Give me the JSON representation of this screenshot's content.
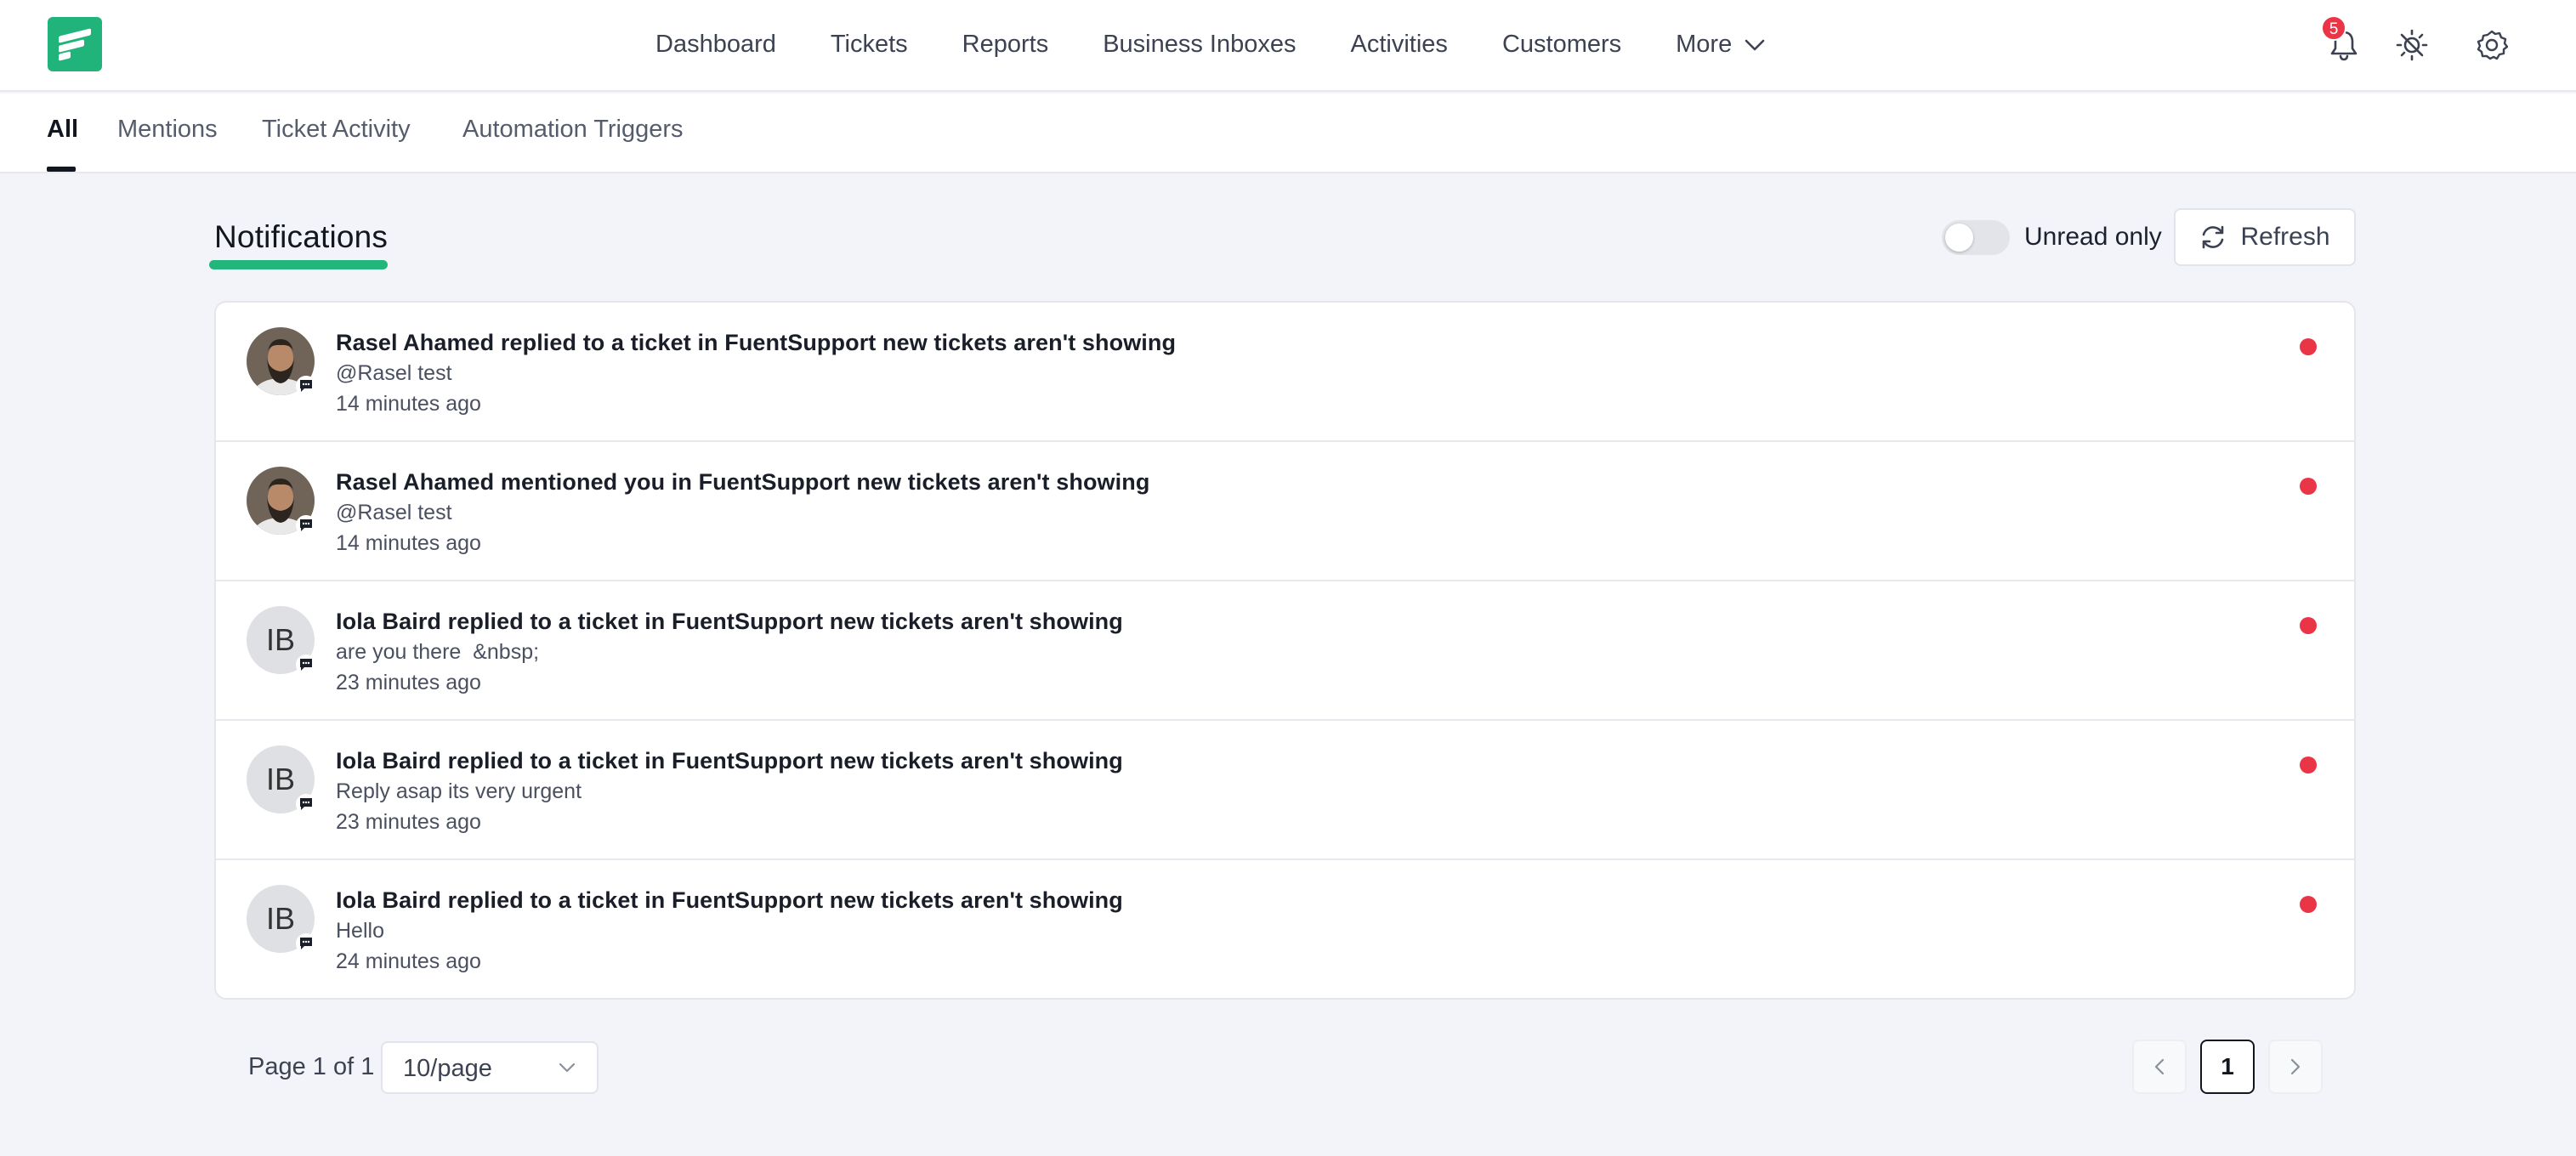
{
  "nav": {
    "items": [
      {
        "label": "Dashboard"
      },
      {
        "label": "Tickets"
      },
      {
        "label": "Reports"
      },
      {
        "label": "Business Inboxes"
      },
      {
        "label": "Activities"
      },
      {
        "label": "Customers"
      },
      {
        "label": "More"
      }
    ],
    "notification_count": "5",
    "icons": [
      "bell-icon",
      "theme-toggle-icon",
      "settings-gear-icon"
    ]
  },
  "tabs": [
    {
      "label": "All",
      "active": true
    },
    {
      "label": "Mentions"
    },
    {
      "label": "Ticket Activity"
    },
    {
      "label": "Automation Triggers"
    }
  ],
  "header": {
    "title": "Notifications",
    "unread_only_label": "Unread only",
    "unread_only_enabled": false,
    "refresh_label": "Refresh"
  },
  "notifications": [
    {
      "avatar": "photo",
      "title": "Rasel Ahamed replied to a ticket in FuentSupport new tickets aren't showing",
      "body": "@Rasel test",
      "time": "14 minutes ago",
      "unread": true
    },
    {
      "avatar": "photo",
      "title": "Rasel Ahamed mentioned you in FuentSupport new tickets aren't showing",
      "body": "@Rasel test",
      "time": "14 minutes ago",
      "unread": true
    },
    {
      "avatar_initials": "IB",
      "title": "Iola Baird replied to a ticket in FuentSupport new tickets aren't showing",
      "body": "are you there  &nbsp;",
      "time": "23 minutes ago",
      "unread": true
    },
    {
      "avatar_initials": "IB",
      "title": "Iola Baird replied to a ticket in FuentSupport new tickets aren't showing",
      "body": "Reply asap its very urgent",
      "time": "23 minutes ago",
      "unread": true
    },
    {
      "avatar_initials": "IB",
      "title": "Iola Baird replied to a ticket in FuentSupport new tickets aren't showing",
      "body": "Hello",
      "time": "24 minutes ago",
      "unread": true
    }
  ],
  "pagination": {
    "page_info": "Page 1 of 1",
    "per_page": "10/page",
    "current_page": "1"
  },
  "colors": {
    "brand": "#20b47a",
    "unread": "#ea3546",
    "background": "#f3f4f9"
  }
}
